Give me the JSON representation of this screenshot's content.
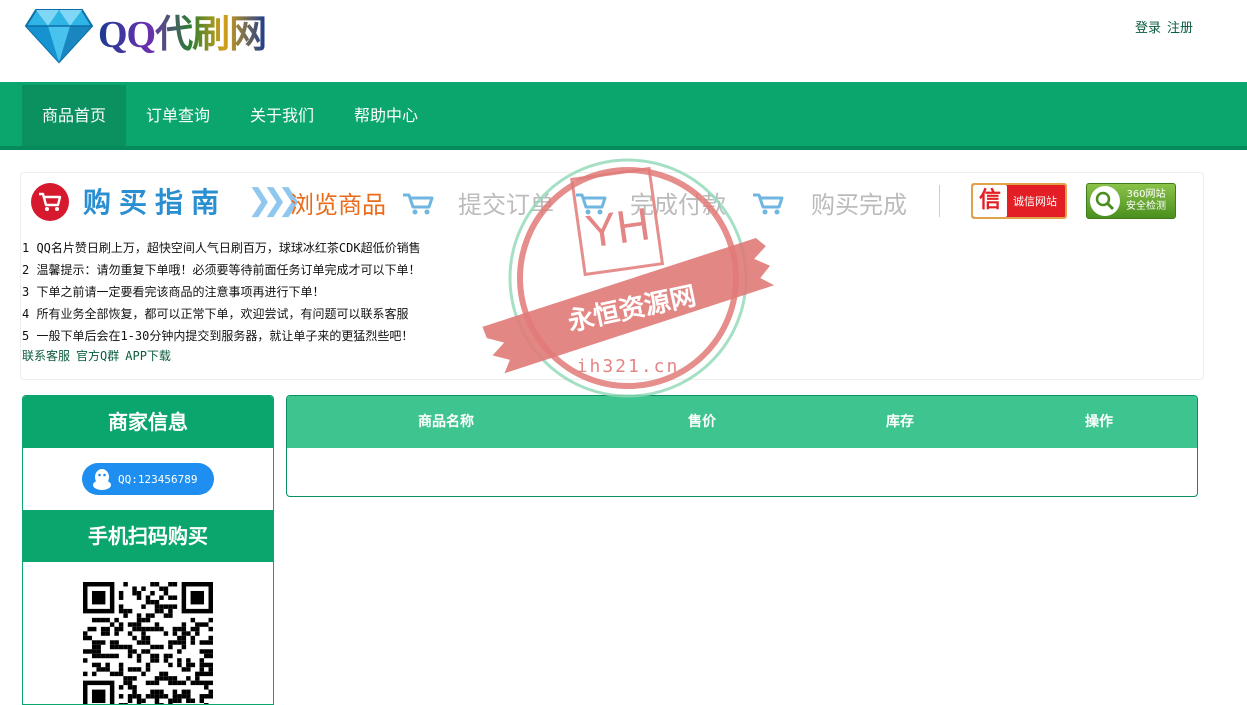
{
  "header": {
    "logo_text": "QQ代刷网",
    "login_label": "登录",
    "register_label": "注册"
  },
  "nav": {
    "items": [
      {
        "label": "商品首页"
      },
      {
        "label": "订单查询"
      },
      {
        "label": "关于我们"
      },
      {
        "label": "帮助中心"
      }
    ],
    "active_index": 0
  },
  "guide": {
    "title": "购买指南",
    "steps": [
      "浏览商品",
      "提交订单",
      "完成付款",
      "购买完成"
    ],
    "active_step": 0,
    "badge_trust": {
      "glyph": "信",
      "label": "诚信网站"
    },
    "badge_360": {
      "line1": "360网站",
      "line2": "安全检测"
    }
  },
  "notices": [
    "1 QQ名片赞日刷上万，超快空间人气日刷百万，球球冰红茶CDK超低价销售",
    "2 温馨提示：请勿重复下单哦！必须要等待前面任务订单完成才可以下单！",
    "3 下单之前请一定要看完该商品的注意事项再进行下单！",
    "4 所有业务全部恢复，都可以正常下单，欢迎尝试，有问题可以联系客服",
    "5 一般下单后会在1-30分钟内提交到服务器，就让单子来的更猛烈些吧！"
  ],
  "links": [
    "联系客服",
    "官方Q群",
    "APP下载"
  ],
  "merchant": {
    "title": "商家信息",
    "qq_label": "QQ:123456789",
    "scan_title": "手机扫码购买"
  },
  "goods_table": {
    "columns": [
      "商品名称",
      "售价",
      "库存",
      "操作"
    ],
    "rows": []
  },
  "watermark": {
    "monogram": "YH",
    "name": "永恒资源网",
    "url": "ih321.cn"
  },
  "colors": {
    "brand_green": "#0aa66d",
    "table_head": "#3ec48f",
    "active_step": "#e96b1a",
    "stamp_red": "#e07a78"
  },
  "icons": [
    "diamond-logo-icon",
    "shopping-cart-icon",
    "penguin-icon",
    "qr-code-icon",
    "magnifier-shield-icon"
  ]
}
